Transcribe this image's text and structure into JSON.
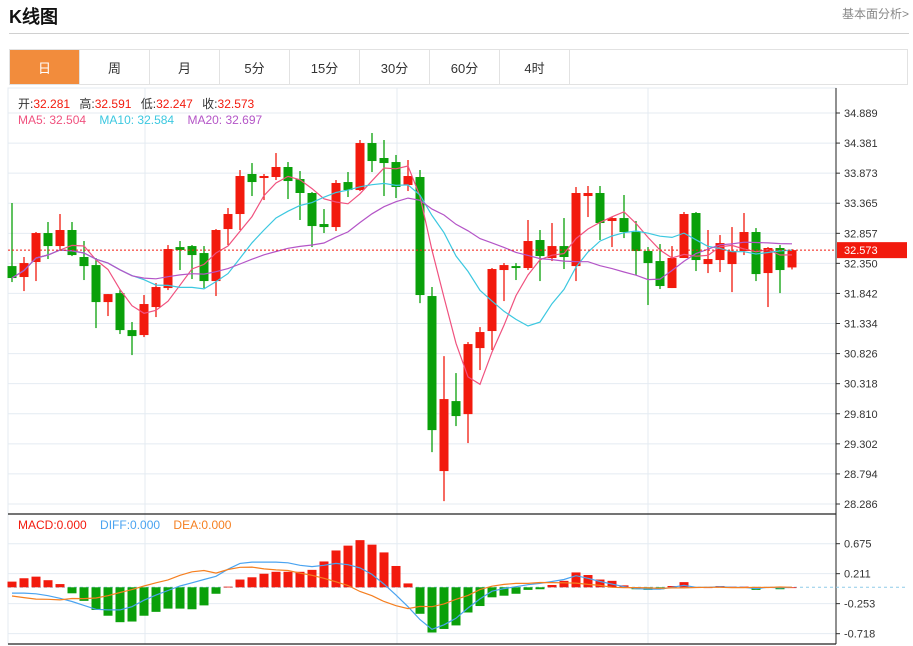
{
  "header": {
    "title": "K线图",
    "link": "基本面分析>"
  },
  "tabs": [
    {
      "label": "日",
      "active": true
    },
    {
      "label": "周"
    },
    {
      "label": "月"
    },
    {
      "label": "5分"
    },
    {
      "label": "15分"
    },
    {
      "label": "30分"
    },
    {
      "label": "60分"
    },
    {
      "label": "4时"
    }
  ],
  "ohlc_legend": {
    "open_label": "开:",
    "open": "32.281",
    "high_label": "高:",
    "high": "32.591",
    "low_label": "低:",
    "low": "32.247",
    "close_label": "收:",
    "close": "32.573"
  },
  "ma_legend": {
    "ma5": "MA5: 32.504",
    "ma10": "MA10: 32.584",
    "ma20": "MA20: 32.697"
  },
  "macd_legend": {
    "macd": "MACD:0.000",
    "diff": "DIFF:0.000",
    "dea": "DEA:0.000"
  },
  "colors": {
    "up": "#f21a0d",
    "down": "#0aa00a",
    "ma5": "#f0527f",
    "ma10": "#3cc8e0",
    "ma20": "#b455c7",
    "diff": "#4aa3f0",
    "dea": "#f57f20",
    "active_tab": "#f28c3c"
  },
  "chart_data": [
    {
      "type": "candlestick",
      "y_ticks": [
        "34.889",
        "34.381",
        "33.873",
        "33.365",
        "32.857",
        "32.350",
        "31.842",
        "31.334",
        "30.826",
        "30.318",
        "29.810",
        "29.302",
        "28.794",
        "28.286"
      ],
      "ylim": [
        28.286,
        34.889
      ],
      "last_price": "32.573",
      "moving_averages": [
        5,
        10,
        20
      ],
      "ohlc": [
        [
          32.304,
          33.369,
          32.034,
          32.102
        ],
        [
          32.119,
          32.457,
          31.882,
          32.355
        ],
        [
          32.372,
          32.879,
          32.051,
          32.862
        ],
        [
          32.862,
          33.048,
          32.423,
          32.642
        ],
        [
          32.642,
          33.183,
          32.575,
          32.913
        ],
        [
          32.913,
          33.048,
          32.473,
          32.49
        ],
        [
          32.457,
          32.727,
          32.068,
          32.304
        ],
        [
          32.321,
          32.44,
          31.257,
          31.696
        ],
        [
          31.696,
          31.831,
          31.46,
          31.831
        ],
        [
          31.848,
          31.899,
          31.156,
          31.223
        ],
        [
          31.223,
          31.359,
          30.801,
          31.122
        ],
        [
          31.139,
          31.815,
          31.105,
          31.663
        ],
        [
          31.612,
          32.017,
          31.443,
          31.95
        ],
        [
          31.933,
          32.659,
          31.899,
          32.592
        ],
        [
          32.625,
          32.727,
          32.237,
          32.575
        ],
        [
          32.642,
          32.659,
          32.085,
          32.49
        ],
        [
          32.524,
          32.642,
          31.933,
          32.051
        ],
        [
          32.051,
          32.929,
          31.798,
          32.913
        ],
        [
          32.929,
          33.284,
          32.659,
          33.183
        ],
        [
          33.183,
          33.926,
          32.913,
          33.825
        ],
        [
          33.859,
          34.044,
          33.487,
          33.723
        ],
        [
          33.791,
          33.859,
          33.419,
          33.825
        ],
        [
          33.808,
          34.213,
          33.757,
          33.977
        ],
        [
          33.977,
          34.061,
          33.436,
          33.74
        ],
        [
          33.774,
          33.909,
          33.082,
          33.538
        ],
        [
          33.538,
          33.554,
          32.625,
          32.98
        ],
        [
          33.014,
          33.267,
          32.862,
          32.963
        ],
        [
          32.963,
          33.757,
          32.896,
          33.707
        ],
        [
          33.723,
          33.892,
          33.47,
          33.588
        ],
        [
          33.588,
          34.433,
          33.571,
          34.382
        ],
        [
          34.382,
          34.551,
          33.892,
          34.078
        ],
        [
          34.129,
          34.433,
          33.487,
          34.044
        ],
        [
          34.061,
          34.18,
          33.453,
          33.639
        ],
        [
          33.673,
          34.095,
          33.571,
          33.825
        ],
        [
          33.808,
          33.926,
          31.679,
          31.815
        ],
        [
          31.798,
          31.95,
          29.162,
          29.534
        ],
        [
          28.842,
          30.784,
          28.335,
          30.058
        ],
        [
          30.024,
          30.497,
          29.602,
          29.771
        ],
        [
          29.804,
          31.021,
          29.315,
          30.987
        ],
        [
          30.919,
          31.274,
          30.548,
          31.19
        ],
        [
          31.207,
          32.271,
          30.886,
          32.254
        ],
        [
          32.237,
          32.355,
          31.713,
          32.321
        ],
        [
          32.304,
          32.355,
          32.068,
          32.271
        ],
        [
          32.271,
          33.082,
          32.237,
          32.727
        ],
        [
          32.744,
          32.913,
          32.051,
          32.473
        ],
        [
          32.44,
          33.031,
          32.389,
          32.642
        ],
        [
          32.642,
          33.115,
          32.254,
          32.457
        ],
        [
          32.304,
          33.639,
          32.051,
          33.538
        ],
        [
          33.487,
          33.656,
          33.132,
          33.538
        ],
        [
          33.538,
          33.656,
          32.744,
          33.031
        ],
        [
          33.065,
          33.132,
          32.625,
          33.115
        ],
        [
          33.115,
          33.504,
          32.777,
          32.879
        ],
        [
          32.879,
          33.065,
          32.153,
          32.558
        ],
        [
          32.558,
          32.625,
          31.646,
          32.355
        ],
        [
          32.389,
          32.676,
          31.916,
          31.967
        ],
        [
          31.933,
          32.642,
          31.933,
          32.44
        ],
        [
          32.44,
          33.217,
          32.44,
          33.183
        ],
        [
          33.2,
          33.217,
          32.22,
          32.406
        ],
        [
          32.338,
          32.913,
          32.186,
          32.423
        ],
        [
          32.406,
          32.828,
          32.203,
          32.693
        ],
        [
          32.338,
          32.963,
          31.865,
          32.558
        ],
        [
          32.558,
          33.2,
          32.49,
          32.879
        ],
        [
          32.879,
          32.946,
          32.051,
          32.169
        ],
        [
          32.186,
          32.625,
          31.612,
          32.609
        ],
        [
          32.609,
          32.659,
          31.848,
          32.237
        ],
        [
          32.281,
          32.591,
          32.247,
          32.573
        ]
      ]
    },
    {
      "type": "macd",
      "y_ticks": [
        "0.675",
        "0.211",
        "-0.253",
        "-0.718"
      ],
      "ylim": [
        -0.718,
        0.675
      ],
      "macd": [
        0.088,
        0.14,
        0.165,
        0.11,
        0.05,
        -0.093,
        -0.21,
        -0.35,
        -0.44,
        -0.54,
        -0.53,
        -0.44,
        -0.38,
        -0.33,
        -0.33,
        -0.34,
        -0.28,
        -0.1,
        0.01,
        0.12,
        0.155,
        0.21,
        0.24,
        0.24,
        0.24,
        0.27,
        0.4,
        0.57,
        0.645,
        0.73,
        0.66,
        0.54,
        0.33,
        0.06,
        -0.41,
        -0.7,
        -0.645,
        -0.59,
        -0.39,
        -0.29,
        -0.155,
        -0.13,
        -0.1,
        -0.04,
        -0.03,
        0.036,
        0.1,
        0.23,
        0.19,
        0.12,
        0.1,
        0.03,
        -0.03,
        -0.04,
        -0.03,
        0.02,
        0.08,
        0.005,
        0.0,
        0.02,
        0.01,
        0.01,
        -0.04,
        0.005,
        -0.03,
        0.0
      ],
      "diff": [
        -0.09,
        -0.09,
        -0.1,
        -0.13,
        -0.17,
        -0.22,
        -0.28,
        -0.34,
        -0.35,
        -0.35,
        -0.3,
        -0.2,
        -0.12,
        -0.05,
        0.02,
        0.07,
        0.12,
        0.17,
        0.28,
        0.37,
        0.39,
        0.39,
        0.39,
        0.38,
        0.34,
        0.32,
        0.34,
        0.37,
        0.35,
        0.3,
        0.2,
        0.05,
        -0.12,
        -0.3,
        -0.5,
        -0.65,
        -0.58,
        -0.48,
        -0.32,
        -0.18,
        -0.06,
        -0.02,
        0.01,
        0.04,
        0.06,
        0.09,
        0.12,
        0.18,
        0.14,
        0.09,
        0.05,
        0.01,
        -0.02,
        -0.03,
        -0.03,
        0.0,
        0.03,
        0.0,
        0.0,
        0.01,
        0.0,
        0.0,
        -0.02,
        0.0,
        -0.01,
        0.0
      ]
    }
  ]
}
